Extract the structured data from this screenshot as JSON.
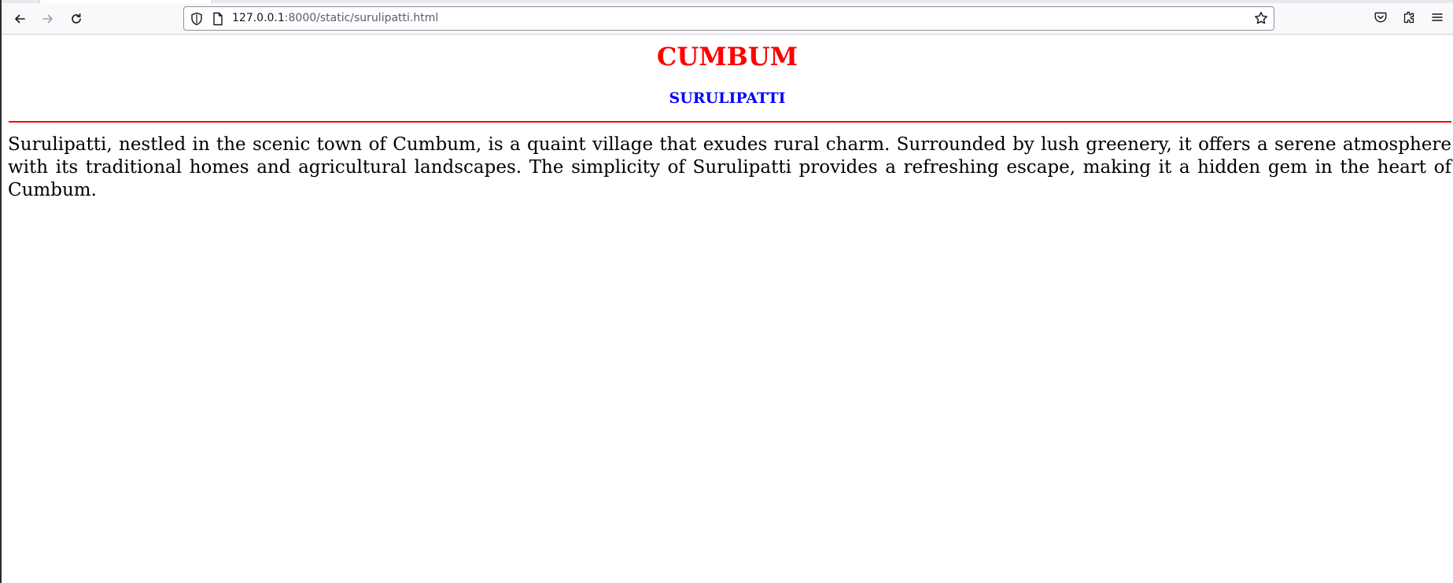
{
  "browser": {
    "url_host": "127.0.0.1",
    "url_path": ":8000/static/surulipatti.html",
    "icons": {
      "back": "arrow-left-icon",
      "forward": "arrow-right-icon",
      "reload": "reload-icon",
      "site_info": "shield-icon",
      "page": "page-icon",
      "bookmark": "star-icon",
      "pocket": "pocket-icon",
      "extensions": "puzzle-icon",
      "menu": "hamburger-menu-icon"
    }
  },
  "page": {
    "title": "CUMBUM",
    "subtitle": "SURULIPATTI",
    "description": "Surulipatti, nestled in the scenic town of Cumbum, is a quaint village that exudes rural charm. Surrounded by lush greenery, it offers a serene atmosphere with its traditional homes and agricultural landscapes. The simplicity of Surulipatti provides a refreshing escape, making it a hidden gem in the heart of Cumbum."
  },
  "colors": {
    "title": "#ff0000",
    "subtitle": "#0000ff",
    "divider": "#ff0000",
    "text": "#000000",
    "toolbar_background": "#f9f9fb"
  }
}
